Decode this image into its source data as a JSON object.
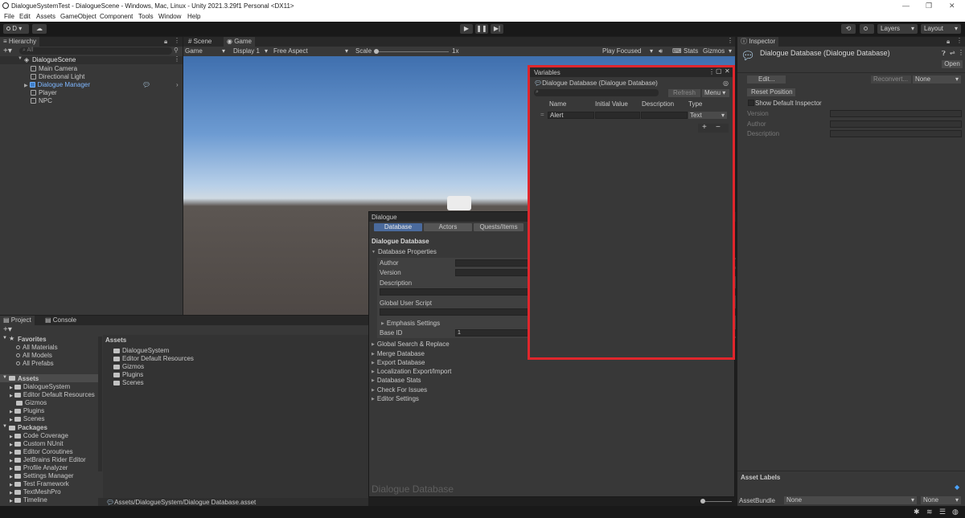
{
  "window": {
    "title": "DialogueSystemTest - DialogueScene - Windows, Mac, Linux - Unity 2021.3.29f1 Personal <DX11>",
    "controls": [
      "—",
      "❐",
      "✕"
    ]
  },
  "menu": [
    "File",
    "Edit",
    "Assets",
    "GameObject",
    "Component",
    "Tools",
    "Window",
    "Help"
  ],
  "toolbar": {
    "account": "D",
    "layers": "Layers",
    "layout": "Layout"
  },
  "hierarchy": {
    "tab": "Hierarchy",
    "search_placeholder": "All",
    "scene": "DialogueScene",
    "items": [
      "Main Camera",
      "Directional Light",
      "Dialogue Manager",
      "Player",
      "NPC"
    ]
  },
  "scene_view": {
    "tabs": [
      "Scene",
      "Game"
    ],
    "game_dropdown": "Game",
    "display": "Display 1",
    "aspect": "Free Aspect",
    "scale_label": "Scale",
    "scale_value": "1x",
    "play_focused": "Play Focused",
    "stats": "Stats",
    "gizmos": "Gizmos"
  },
  "dialogue_window": {
    "title": "Dialogue",
    "tabs": [
      "Database",
      "Actors",
      "Quests/Items"
    ],
    "heading": "Dialogue Database",
    "db_properties": "Database Properties",
    "author": "Author",
    "version": "Version",
    "description": "Description",
    "global_user_script": "Global User Script",
    "emphasis_settings": "Emphasis Settings",
    "base_id_label": "Base ID",
    "base_id_value": "1",
    "sections": [
      "Global Search & Replace",
      "Merge Database",
      "Export Database",
      "Localization Export/Import",
      "Database Stats",
      "Check For Issues",
      "Editor Settings"
    ],
    "watermark": "Dialogue Database"
  },
  "variables_window": {
    "title": "Variables",
    "database": "Dialogue Database (Dialogue Database)",
    "refresh": "Refresh",
    "menu": "Menu",
    "columns": [
      "Name",
      "Initial Value",
      "Description",
      "Type"
    ],
    "rows": [
      {
        "name": "Alert",
        "initial": "",
        "description": "",
        "type": "Text"
      }
    ],
    "add": "+",
    "remove": "−",
    "highlight_color": "#e0262c"
  },
  "inspector": {
    "tab": "Inspector",
    "title": "Dialogue Database (Dialogue Database)",
    "open": "Open",
    "edit": "Edit...",
    "reconvert": "Reconvert...",
    "none_dropdown": "None",
    "reset_position": "Reset Position",
    "show_default": "Show Default Inspector",
    "fields": [
      "Version",
      "Author",
      "Description"
    ],
    "asset_labels": "Asset Labels",
    "asset_bundle_label": "AssetBundle",
    "asset_bundle_value": "None",
    "asset_bundle_variant": "None"
  },
  "project": {
    "tabs": [
      "Project",
      "Console"
    ],
    "favorites": "Favorites",
    "favorite_items": [
      "All Materials",
      "All Models",
      "All Prefabs"
    ],
    "assets": "Assets",
    "asset_folders": [
      "DialogueSystem",
      "Editor Default Resources",
      "Gizmos",
      "Plugins",
      "Scenes"
    ],
    "packages": "Packages",
    "package_items": [
      "Code Coverage",
      "Custom NUnit",
      "Editor Coroutines",
      "JetBrains Rider Editor",
      "Profile Analyzer",
      "Settings Manager",
      "Test Framework",
      "TextMeshPro",
      "Timeline"
    ],
    "main_header": "Assets",
    "main_items": [
      "DialogueSystem",
      "Editor Default Resources",
      "Gizmos",
      "Plugins",
      "Scenes"
    ],
    "path": "Assets/DialogueSystem/Dialogue Database.asset"
  }
}
